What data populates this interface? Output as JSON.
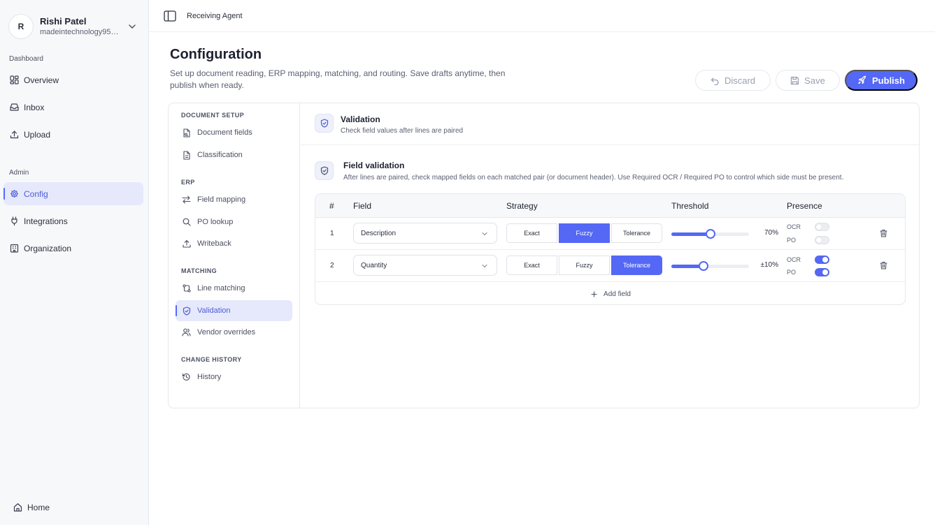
{
  "user": {
    "initial": "R",
    "name": "Rishi Patel",
    "email": "madeintechnology95@gmail.com"
  },
  "nav": {
    "dashboard_label": "Dashboard",
    "admin_label": "Admin",
    "items": [
      {
        "label": "Overview",
        "icon": "grid-icon"
      },
      {
        "label": "Inbox",
        "icon": "inbox-icon"
      },
      {
        "label": "Upload",
        "icon": "upload-icon"
      },
      {
        "label": "Config",
        "icon": "gear-icon",
        "active": true
      },
      {
        "label": "Integrations",
        "icon": "plug-icon"
      },
      {
        "label": "Organization",
        "icon": "building-icon"
      }
    ],
    "home_label": "Home"
  },
  "topbar": {
    "title": "Receiving Agent"
  },
  "header": {
    "title": "Configuration",
    "description": "Set up document reading, ERP mapping, matching, and routing. Save drafts anytime, then publish when ready.",
    "discard_label": "Discard",
    "save_label": "Save",
    "publish_label": "Publish"
  },
  "subnav": {
    "sections": [
      {
        "label": "DOCUMENT SETUP",
        "items": [
          "Document fields",
          "Classification"
        ]
      },
      {
        "label": "ERP",
        "items": [
          "Field mapping",
          "PO lookup",
          "Writeback"
        ]
      },
      {
        "label": "MATCHING",
        "items": [
          "Line matching",
          "Validation",
          "Vendor overrides"
        ]
      },
      {
        "label": "CHANGE HISTORY",
        "items": [
          "History"
        ]
      }
    ],
    "active": "Validation"
  },
  "section": {
    "title": "Validation",
    "subtitle": "Check field values after lines are paired"
  },
  "field_validation": {
    "title": "Field validation",
    "subtitle": "After lines are paired, check mapped fields on each matched pair (or document header). Use Required OCR / Required PO to control which side must be present."
  },
  "table": {
    "headers": {
      "num": "#",
      "field": "Field",
      "strategy": "Strategy",
      "threshold": "Threshold",
      "presence": "Presence"
    },
    "strategies": [
      "Exact",
      "Fuzzy",
      "Tolerance"
    ],
    "presence_labels": {
      "ocr": "OCR",
      "po": "PO"
    },
    "rows": [
      {
        "num": "1",
        "field": "Description",
        "strategy": "Fuzzy",
        "threshold_fraction": 0.5,
        "threshold_text": "70%",
        "ocr_required": false,
        "po_required": false
      },
      {
        "num": "2",
        "field": "Quantity",
        "strategy": "Tolerance",
        "threshold_fraction": 0.41,
        "threshold_text": "±10%",
        "ocr_required": true,
        "po_required": true
      }
    ],
    "add_label": "Add field"
  },
  "colors": {
    "accent": "#5468f5",
    "active_bg": "#e6e9fb",
    "active_text": "#4b5bd6"
  }
}
